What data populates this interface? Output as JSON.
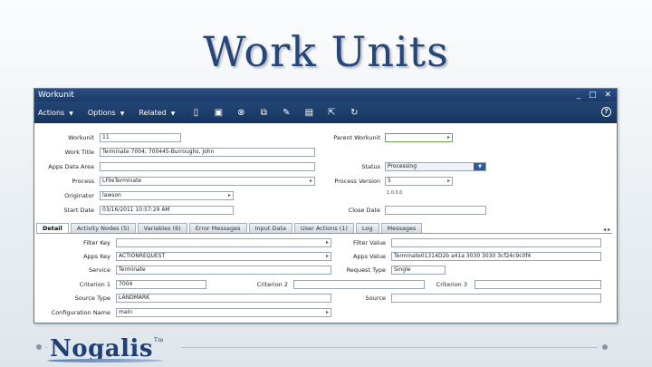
{
  "slide": {
    "title": "Work Units",
    "logo": "Nogalis",
    "logo_tm": "Tm"
  },
  "window": {
    "title": "Workunit",
    "controls": "_ □ ✕",
    "menus": [
      "Actions",
      "Options",
      "Related"
    ],
    "toolbar_icons": [
      "new-doc-icon",
      "save-icon",
      "cancel-icon",
      "copy-icon",
      "edit-icon",
      "view-icon",
      "export-icon",
      "refresh-icon"
    ],
    "help_icon": "?"
  },
  "form": {
    "workunit": {
      "label": "Workunit",
      "value": "11"
    },
    "work_title": {
      "label": "Work Title",
      "value": "Terminate 7004; 700445-Burroughs, John"
    },
    "apps_data_area": {
      "label": "Apps Data Area",
      "value": ""
    },
    "process": {
      "label": "Process",
      "value": "LFileTerminate"
    },
    "originator": {
      "label": "Originator",
      "value": "lawson"
    },
    "start_date": {
      "label": "Start Date",
      "value": "03/16/2011 10:57:29 AM"
    },
    "parent_workunit": {
      "label": "Parent Workunit",
      "value": ""
    },
    "status": {
      "label": "Status",
      "value": "Processing"
    },
    "process_version": {
      "label": "Process Version",
      "value": "5"
    },
    "version_note": "1.0.0.0",
    "close_date": {
      "label": "Close Date",
      "value": ""
    }
  },
  "tabs": [
    "Detail",
    "Activity Nodes (5)",
    "Variables (6)",
    "Error Messages",
    "Input Data",
    "User Actions (1)",
    "Log",
    "Messages"
  ],
  "tab_arrows": "◂ ▸",
  "detail": {
    "filter_key": {
      "label": "Filter Key",
      "value": ""
    },
    "apps_key": {
      "label": "Apps Key",
      "value": "ACTIONREQUEST"
    },
    "service": {
      "label": "Service",
      "value": "Terminate"
    },
    "criterion1": {
      "label": "Criterion 1",
      "value": "7004"
    },
    "source_type": {
      "label": "Source Type",
      "value": "LANDMARK"
    },
    "configuration_name": {
      "label": "Configuration Name",
      "value": "main"
    },
    "filter_value": {
      "label": "Filter Value",
      "value": ""
    },
    "apps_value": {
      "label": "Apps Value",
      "value": "Terminate01314D2b a41a 3030 3030 3cf24c9c0f4"
    },
    "request_type": {
      "label": "Request Type",
      "value": "Single"
    },
    "criterion2": {
      "label": "Criterion 2",
      "value": ""
    },
    "criterion3": {
      "label": "Criterion 3",
      "value": ""
    },
    "source": {
      "label": "Source",
      "value": ""
    }
  },
  "colors": {
    "title": "#24467a",
    "menubar": "#1b3a68",
    "accent": "#2e5c96"
  }
}
